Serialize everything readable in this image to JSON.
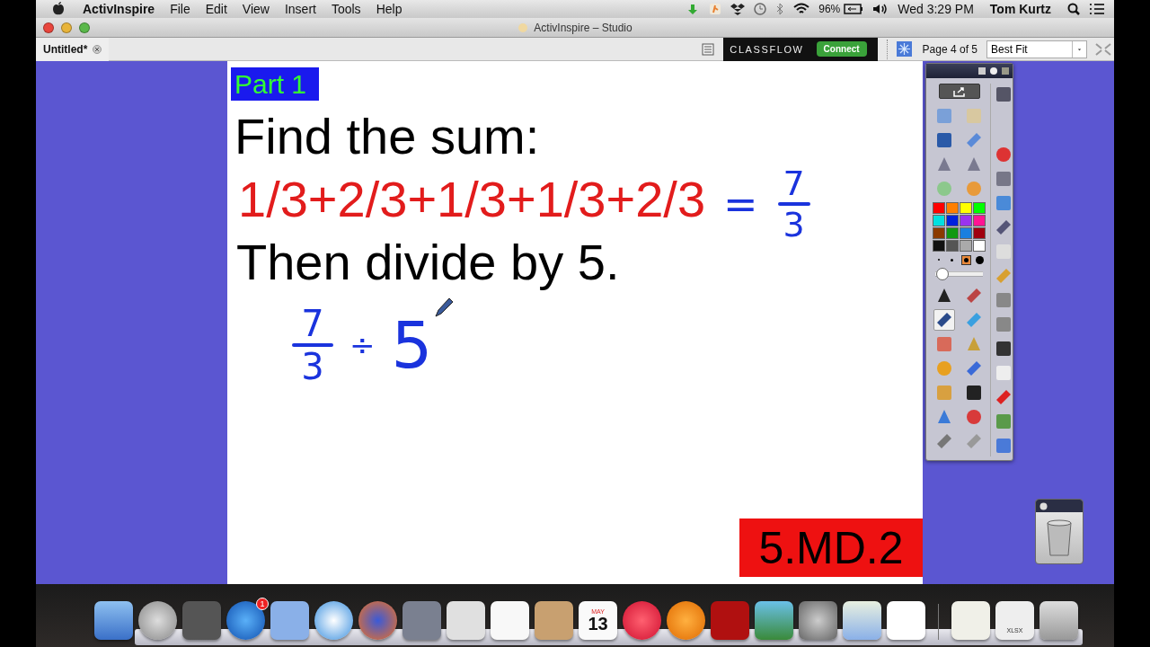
{
  "menu_bar": {
    "app_name": "ActivInspire",
    "menus": [
      "File",
      "Edit",
      "View",
      "Insert",
      "Tools",
      "Help"
    ],
    "battery": "96%",
    "clock": "Wed 3:29 PM",
    "user": "Tom Kurtz"
  },
  "window": {
    "title": "ActivInspire – Studio"
  },
  "tabs": [
    {
      "label": "Untitled*",
      "selected": true
    }
  ],
  "toolbar": {
    "brand": "CLASSFLOW",
    "connect_button": "Connect",
    "page_indicator": "Page 4 of 5",
    "zoom": "Best Fit"
  },
  "page": {
    "tag": "Part 1",
    "heading": "Find the sum:",
    "expression": "1/3+2/3+1/3+1/3+2/3",
    "ink_result": {
      "equals": "=",
      "numerator": "7",
      "denominator": "3"
    },
    "instruction": "Then divide by 5.",
    "ink_work": {
      "numerator": "7",
      "denominator": "3",
      "operator": "÷",
      "divisor": "5"
    },
    "standard": "5.MD.2"
  },
  "toolbox": {
    "colors": [
      {
        "color": "#ff0000"
      },
      {
        "color": "#ff7f00"
      },
      {
        "color": "#ffff00"
      },
      {
        "color": "#00ff00"
      },
      {
        "color": "#00e0e0"
      },
      {
        "color": "#0022dd"
      },
      {
        "color": "#9933ee"
      },
      {
        "color": "#ff1493"
      },
      {
        "color": "#8b3a00"
      },
      {
        "color": "#119911"
      },
      {
        "color": "#1a7fe0"
      },
      {
        "color": "#a00010"
      },
      {
        "color": "#111111"
      },
      {
        "color": "#555555"
      },
      {
        "color": "#aaaaaa"
      },
      {
        "color": "#ffffff"
      }
    ],
    "pen_sizes": [
      {
        "selected": false
      },
      {
        "selected": false
      },
      {
        "selected": true
      },
      {
        "selected": false
      }
    ],
    "width_slider": {
      "level": 0.15
    },
    "tools": [
      {
        "selected": false
      },
      {
        "selected": false
      },
      {
        "selected": true
      },
      {
        "selected": false
      },
      {
        "selected": false
      },
      {
        "selected": false
      },
      {
        "selected": false
      },
      {
        "selected": false
      },
      {
        "selected": false
      },
      {
        "selected": false
      }
    ]
  },
  "dock": {
    "app_store_badge": "1",
    "calendar_month": "MAY",
    "calendar_day": "13",
    "file_type": "XLSX"
  }
}
